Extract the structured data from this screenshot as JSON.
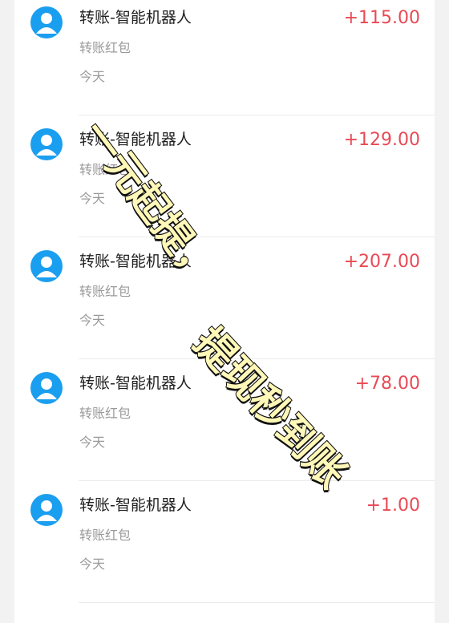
{
  "transactions": [
    {
      "title": "转账-智能机器人",
      "subtitle": "转账红包",
      "date": "今天",
      "amount": "+115.00"
    },
    {
      "title": "转账-智能机器人",
      "subtitle": "转账红包",
      "date": "今天",
      "amount": "+129.00"
    },
    {
      "title": "转账-智能机器人",
      "subtitle": "转账红包",
      "date": "今天",
      "amount": "+207.00"
    },
    {
      "title": "转账-智能机器人",
      "subtitle": "转账红包",
      "date": "今天",
      "amount": "+78.00"
    },
    {
      "title": "转账-智能机器人",
      "subtitle": "转账红包",
      "date": "今天",
      "amount": "+1.00"
    }
  ],
  "overlay": {
    "line1": "一元起提，",
    "line2": "提现秒到账"
  },
  "colors": {
    "amount": "#e94a55",
    "avatar": "#1a9ef0"
  },
  "icons": {
    "avatar": "user-avatar-icon"
  }
}
